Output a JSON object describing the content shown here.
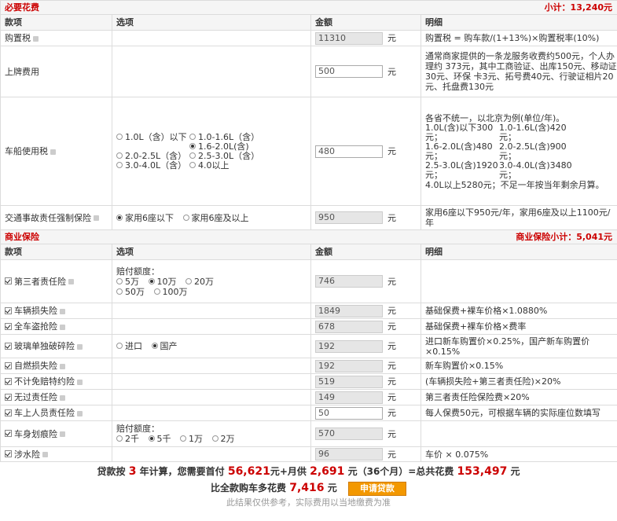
{
  "required": {
    "title": "必要花费",
    "subtotal": "小计：13,240元",
    "headers": [
      "款项",
      "选项",
      "金额",
      "明细"
    ],
    "purchase_tax": {
      "label": "购置税",
      "amount": "11310",
      "unit": "元",
      "detail": "购置税 = 购车款/(1+13%)×购置税率(10%)"
    },
    "plate": {
      "label": "上牌费用",
      "amount": "500",
      "unit": "元",
      "detail": "通常商家提供的一条龙服务收费约500元，个人办理约 373元，其中工商验证、出库150元、移动证30元、环保 卡3元、拓号费40元、行驶证相片20元、托盘费130元"
    },
    "vehicle_tax": {
      "label": "车船使用税",
      "amount": "480",
      "unit": "元",
      "options": [
        "1.0L（含）以下",
        "1.0-1.6L（含）",
        "1.6-2.0L(含)",
        "2.0-2.5L（含）",
        "2.5-3.0L（含）",
        "3.0-4.0L（含）",
        "4.0以上"
      ],
      "detail_intro": "各省不统一，以北京为例(单位/年)。",
      "detail_cells": [
        "1.0L(含)以下300元；",
        "1.0-1.6L(含)420元；",
        "1.6-2.0L(含)480元；",
        "2.0-2.5L(含)900元；",
        "2.5-3.0L(含)1920元；",
        "3.0-4.0L(含)3480元；"
      ],
      "detail_tail": "4.0L以上5280元；不足一年按当年剩余月算。"
    },
    "compulsory": {
      "label": "交通事故责任强制保险",
      "amount": "950",
      "unit": "元",
      "options": [
        "家用6座以下",
        "家用6座及以上"
      ],
      "detail": "家用6座以下950元/年，家用6座及以上1100元/年"
    }
  },
  "commercial": {
    "title": "商业保险",
    "subtotal": "商业保险小计：5,041元",
    "headers": [
      "款项",
      "选项",
      "金额",
      "明细"
    ],
    "third_party": {
      "label": "第三者责任险",
      "amount": "746",
      "unit": "元",
      "amount_label": "赔付额度：",
      "options": [
        "5万",
        "10万",
        "20万",
        "50万",
        "100万"
      ]
    },
    "damage": {
      "label": "车辆损失险",
      "amount": "1849",
      "unit": "元",
      "detail": "基础保费+裸车价格×1.0880%"
    },
    "theft": {
      "label": "全车盗抢险",
      "amount": "678",
      "unit": "元",
      "detail": "基础保费+裸车价格×费率"
    },
    "glass": {
      "label": "玻璃单独破碎险",
      "amount": "192",
      "unit": "元",
      "options": [
        "进口",
        "国产"
      ],
      "detail": "进口新车购置价×0.25%，国产新车购置价×0.15%"
    },
    "fire": {
      "label": "自燃损失险",
      "amount": "192",
      "unit": "元",
      "detail": "新车购置价×0.15%"
    },
    "deductible": {
      "label": "不计免赔特约险",
      "amount": "519",
      "unit": "元",
      "detail": "(车辆损失险+第三者责任险)×20%"
    },
    "no_fault": {
      "label": "无过责任险",
      "amount": "149",
      "unit": "元",
      "detail": "第三者责任险保险费×20%"
    },
    "passenger": {
      "label": "车上人员责任险",
      "amount": "50",
      "unit": "元",
      "detail": "每人保费50元，可根据车辆的实际座位数填写"
    },
    "scratch": {
      "label": "车身划痕险",
      "amount": "570",
      "unit": "元",
      "amount_label": "赔付额度：",
      "options": [
        "2千",
        "5千",
        "1万",
        "2万"
      ]
    },
    "flood": {
      "label": "涉水险",
      "amount": "96",
      "unit": "元",
      "detail": "车价 × 0.075%"
    }
  },
  "summary": {
    "loan_prefix": "贷款按",
    "years": "3",
    "years_suffix": "年计算，您需要首付",
    "down_payment": "56,621",
    "monthly_prefix": "元+月供",
    "monthly": "2,691",
    "months_note": "元（36个月）=总共花费",
    "total": "153,497",
    "total_suffix": "元",
    "extra_prefix": "比全款购车多花费",
    "extra": "7,416",
    "extra_suffix": "元",
    "apply_button": "申请贷款",
    "note": "此结果仅供参考，实际费用以当地缴费为准"
  }
}
